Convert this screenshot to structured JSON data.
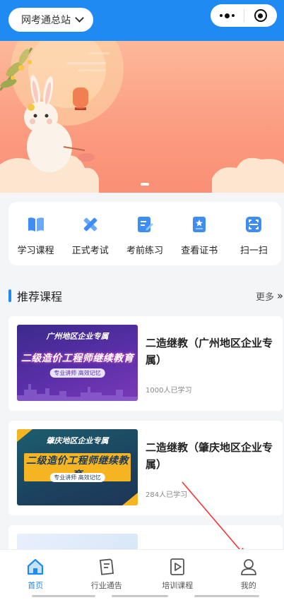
{
  "header": {
    "site_selector": "网考通总站",
    "colors": {
      "primary": "#1e8af2"
    }
  },
  "banner": {
    "alt_theme": "mid-autumn-rabbit-lantern"
  },
  "quick_actions": [
    {
      "label": "学习课程",
      "icon": "book-icon"
    },
    {
      "label": "正式考试",
      "icon": "pencil-ruler-icon"
    },
    {
      "label": "考前练习",
      "icon": "edit-note-icon"
    },
    {
      "label": "查看证书",
      "icon": "certificate-icon"
    },
    {
      "label": "扫一扫",
      "icon": "scan-icon"
    }
  ],
  "recommended": {
    "title": "推荐课程",
    "more": "更多",
    "courses": [
      {
        "title": "二造继教（广州地区企业专属）",
        "learners": "1000人已学习",
        "thumb_line1": "广州地区企业专属",
        "thumb_line2": "二级造价工程师继续教育",
        "thumb_line3": "专业讲师 高效记忆"
      },
      {
        "title": "二造继教（肇庆地区企业专属）",
        "learners": "284人已学习",
        "thumb_line1": "肇庆地区企业专属",
        "thumb_line2": "二级造价工程师继续教育",
        "thumb_line3": "专业讲师 高效记忆"
      }
    ]
  },
  "tabbar": [
    {
      "label": "首页",
      "icon": "home-icon",
      "active": true
    },
    {
      "label": "行业通告",
      "icon": "notice-icon",
      "active": false
    },
    {
      "label": "培训课程",
      "icon": "video-course-icon",
      "active": false
    },
    {
      "label": "我的",
      "icon": "user-icon",
      "active": false
    }
  ]
}
